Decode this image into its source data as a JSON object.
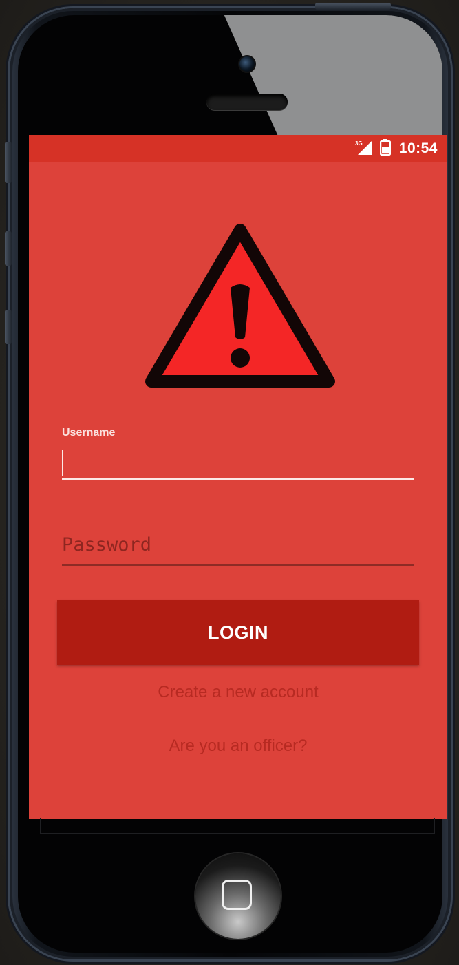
{
  "status_bar": {
    "time": "10:54",
    "icons": [
      "signal-icon",
      "battery-icon"
    ],
    "color": "#d63226"
  },
  "logo": {
    "icon": "warning-icon"
  },
  "form": {
    "username_label": "Username",
    "username_value": "",
    "password_placeholder": "Password",
    "password_value": ""
  },
  "actions": {
    "login_label": "LOGIN",
    "create_account_label": "Create a new account",
    "officer_label": "Are you an officer?"
  },
  "colors": {
    "screen_background": "#dd423a",
    "button_background": "#b01c12",
    "link_text": "#b72a22"
  }
}
